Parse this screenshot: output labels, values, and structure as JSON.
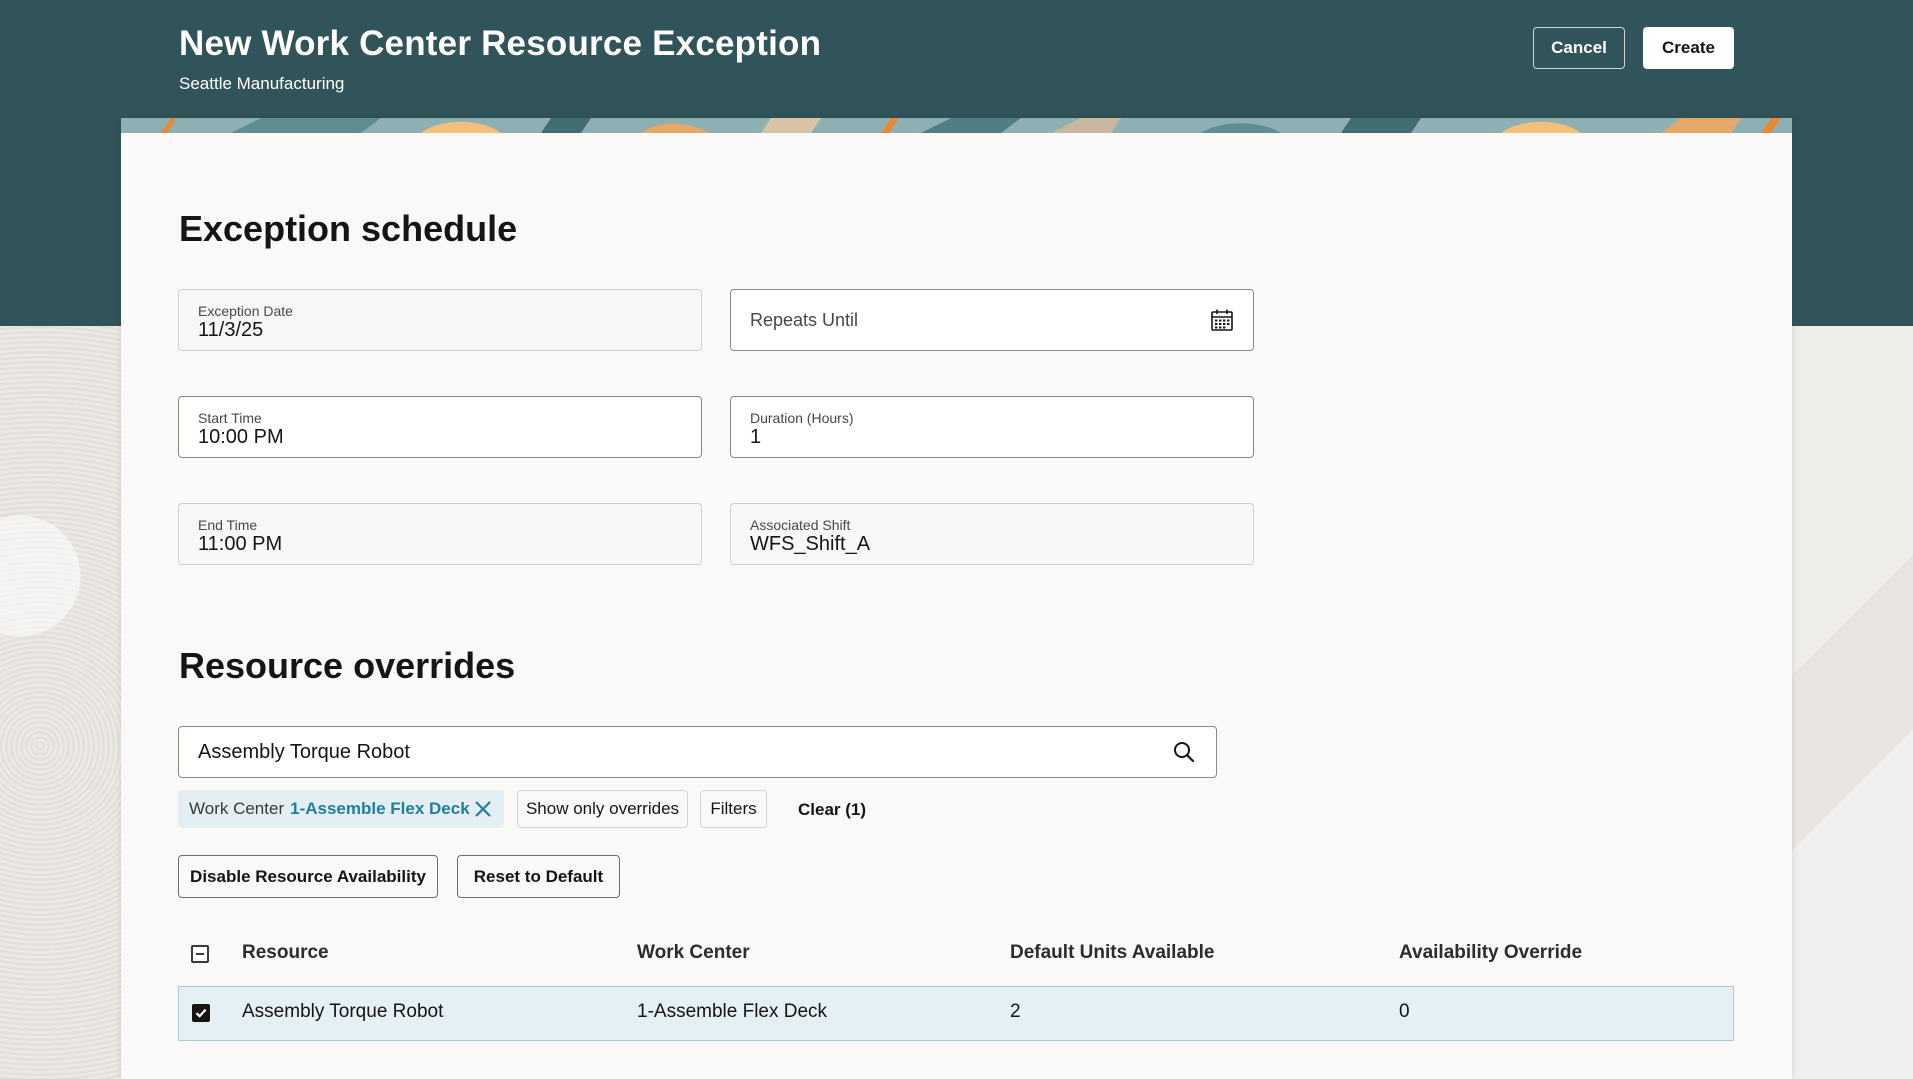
{
  "header": {
    "title": "New Work Center Resource Exception",
    "subtitle": "Seattle Manufacturing",
    "cancel_label": "Cancel",
    "create_label": "Create"
  },
  "exception_schedule": {
    "heading": "Exception schedule",
    "exception_date": {
      "label": "Exception Date",
      "value": "11/3/25"
    },
    "repeats_until": {
      "label": "Repeats Until",
      "value": ""
    },
    "start_time": {
      "label": "Start Time",
      "value": "10:00 PM"
    },
    "duration": {
      "label": "Duration (Hours)",
      "value": "1"
    },
    "end_time": {
      "label": "End Time",
      "value": "11:00 PM"
    },
    "associated_shift": {
      "label": "Associated Shift",
      "value": "WFS_Shift_A"
    }
  },
  "resource_overrides": {
    "heading": "Resource overrides",
    "search_value": "Assembly Torque Robot",
    "filter_chip": {
      "key": "Work Center",
      "value": "1-Assemble Flex Deck"
    },
    "show_only_overrides_label": "Show only overrides",
    "filters_label": "Filters",
    "clear_label": "Clear (1)",
    "disable_label": "Disable Resource Availability",
    "reset_label": "Reset to Default",
    "table": {
      "columns": [
        "Resource",
        "Work Center",
        "Default Units Available",
        "Availability Override"
      ],
      "rows": [
        {
          "selected": true,
          "resource": "Assembly Torque Robot",
          "work_center": "1-Assemble Flex Deck",
          "default_units": "2",
          "override": "0"
        }
      ]
    }
  },
  "colors": {
    "header_band": "#30545a",
    "card": "#fbf9f8",
    "selected_row": "#e4f0f4",
    "link": "#227e9e"
  }
}
